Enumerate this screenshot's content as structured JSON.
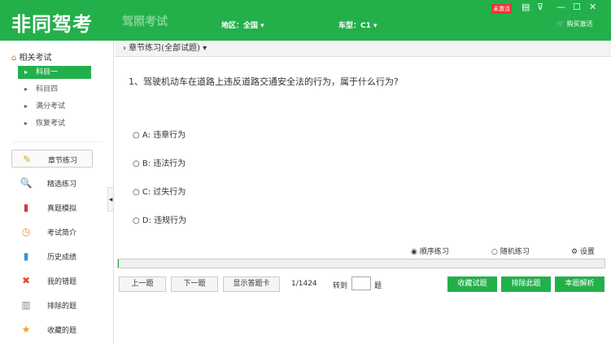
{
  "header": {
    "logo": "非同驾考",
    "subtitle": "驾照考试",
    "region": "地区：全国 ▾",
    "car_type": "车型：C1 ▾",
    "badge": "未激活",
    "buy": "🛒 购买激活"
  },
  "window_controls": [
    "▤",
    "⊽",
    "—",
    "☐",
    "✕"
  ],
  "sidebar": {
    "section": "相关考试",
    "exams": [
      {
        "label": "科目一",
        "active": true
      },
      {
        "label": "科目四"
      },
      {
        "label": "满分考试"
      },
      {
        "label": "恢复考试"
      }
    ],
    "nav": [
      {
        "icon": "✎",
        "label": "章节练习",
        "active": true,
        "color": "#e0a020"
      },
      {
        "icon": "🔍",
        "label": "精选练习",
        "color": "#3a8fd0"
      },
      {
        "icon": "▮",
        "label": "真题模拟",
        "color": "#d03a3a"
      },
      {
        "icon": "◷",
        "label": "考试简介",
        "color": "#f08a20"
      },
      {
        "icon": "▮",
        "label": "历史成绩",
        "color": "#2a9ad0"
      },
      {
        "icon": "✖",
        "label": "我的错题",
        "color": "#e05020"
      },
      {
        "icon": "▥",
        "label": "排除的题",
        "color": "#888"
      },
      {
        "icon": "★",
        "label": "收藏的题",
        "color": "#f0a020"
      }
    ]
  },
  "breadcrumb": "› 章节练习(全部试题) ▾",
  "question": {
    "text": "1、驾驶机动车在道路上违反道路交通安全法的行为，属于什么行为?",
    "options": [
      "○ A: 违章行为",
      "○ B: 违法行为",
      "○ C: 过失行为",
      "○ D: 违规行为"
    ]
  },
  "modes": {
    "sequential": "◉ 顺序练习",
    "random": "○ 随机练习",
    "settings": "⚙ 设置"
  },
  "progress": {
    "current": 1,
    "total": 1424,
    "text": "1/1424"
  },
  "controls": {
    "prev": "上一题",
    "next": "下一题",
    "show_card": "显示答题卡",
    "goto": "转到",
    "goto_value": "",
    "goto_suffix": "题",
    "collect": "收藏试题",
    "exclude": "排除此题",
    "explain": "本题解析"
  }
}
